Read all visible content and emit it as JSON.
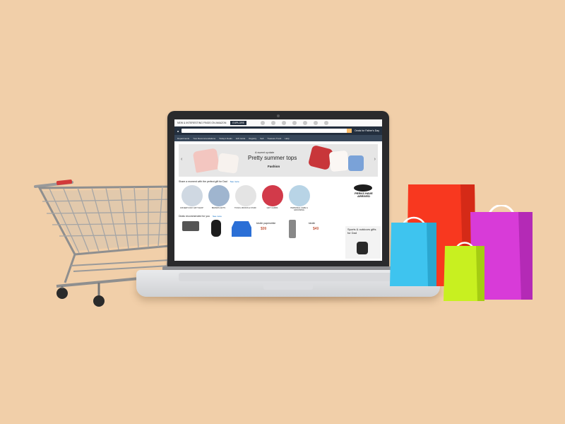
{
  "colors": {
    "background": "#f1cfa9",
    "bag_red": "#f8381f",
    "bag_magenta": "#d83bd8",
    "bag_cyan": "#3ec4ef",
    "bag_lime": "#c8f020"
  },
  "screen": {
    "promo_text": "NEW & INTERESTING FINDS ON AMAZON",
    "promo_button": "EXPLORE",
    "deal_text": "Deals for Father's Day",
    "nav_items": [
      "Departments",
      "Your Recommendations",
      "Today's Deals",
      "Gift Cards",
      "Registry",
      "Sell",
      "Treasure Truck",
      "Help"
    ],
    "hero": {
      "subtitle": "A sweet update",
      "title": "Pretty summer tops",
      "tag": "Fashion"
    },
    "gift_section": {
      "title": "Share a moment with the perfect gift for Dad",
      "link": "See more",
      "items": [
        "FATHER'S DAY GIFT SHOP",
        "BRANDS GIFTS",
        "TOOLS, BOOKS & STUFF",
        "GIFT CARDS",
        "PERSONAL CARE & GROOMING"
      ]
    },
    "deals_section": {
      "title": "Deals recommended for you",
      "link": "See more",
      "kindle_label_1": "kindle paperwhite",
      "kindle_price_1": "$99",
      "kindle_label_2": "kindle",
      "kindle_price_2": "$49"
    },
    "perks_text": "PERKS HAVE ARRIVED",
    "sports_text": "Sports & outdoors gifts for Dad"
  }
}
